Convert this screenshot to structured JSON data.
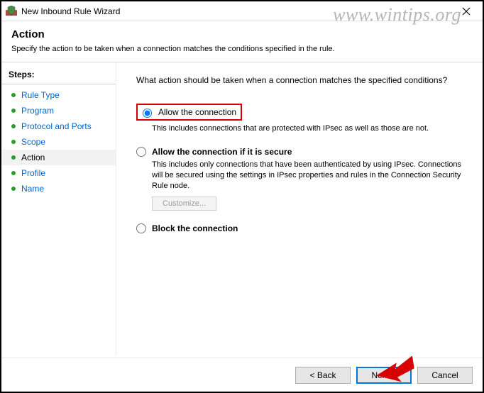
{
  "window": {
    "title": "New Inbound Rule Wizard"
  },
  "header": {
    "title": "Action",
    "description": "Specify the action to be taken when a connection matches the conditions specified in the rule."
  },
  "sidebar": {
    "title": "Steps:",
    "items": [
      {
        "label": "Rule Type",
        "current": false
      },
      {
        "label": "Program",
        "current": false
      },
      {
        "label": "Protocol and Ports",
        "current": false
      },
      {
        "label": "Scope",
        "current": false
      },
      {
        "label": "Action",
        "current": true
      },
      {
        "label": "Profile",
        "current": false
      },
      {
        "label": "Name",
        "current": false
      }
    ]
  },
  "content": {
    "prompt": "What action should be taken when a connection matches the specified conditions?",
    "options": {
      "allow": {
        "label": "Allow the connection",
        "subtext": "This includes connections that are protected with IPsec as well as those are not."
      },
      "allow_secure": {
        "label": "Allow the connection if it is secure",
        "subtext": "This includes only connections that have been authenticated by using IPsec.  Connections will be secured using the settings in IPsec properties and rules in the Connection Security Rule node.",
        "customize_label": "Customize..."
      },
      "block": {
        "label": "Block the connection"
      }
    }
  },
  "footer": {
    "back": "< Back",
    "next": "Next >",
    "cancel": "Cancel"
  },
  "watermark": "www.wintips.org"
}
